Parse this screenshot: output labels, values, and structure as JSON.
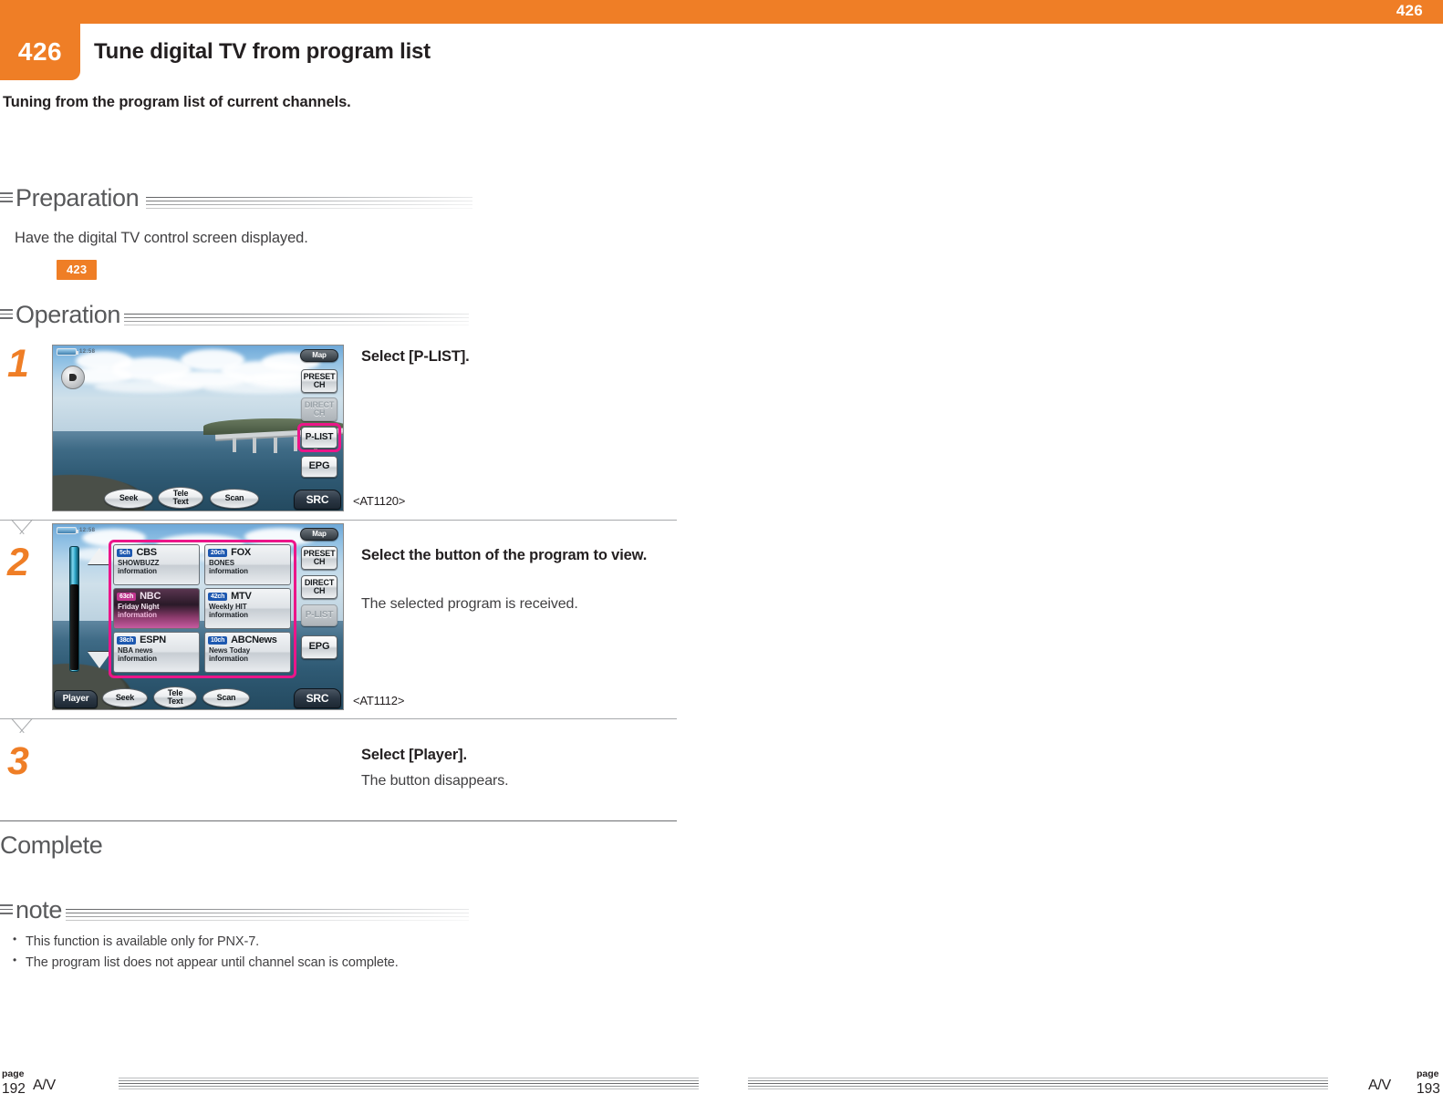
{
  "header": {
    "top_page_number": "426",
    "section_number": "426",
    "title": "Tune digital TV from program list",
    "subtitle": "Tuning from the program list of current channels."
  },
  "preparation": {
    "label": "Preparation",
    "text": "Have the digital TV control screen displayed.",
    "reference_page": "423"
  },
  "operation": {
    "label": "Operation",
    "steps": [
      {
        "number": "1",
        "heading": "Select [P-LIST].",
        "sub": "",
        "caption": "<AT1120>"
      },
      {
        "number": "2",
        "heading": "Select the button of the program to view.",
        "sub": "The selected program is received.",
        "caption": "<AT1112>"
      },
      {
        "number": "3",
        "heading": "Select [Player].",
        "sub": "The button disappears.",
        "caption": ""
      }
    ]
  },
  "complete": {
    "label": "Complete"
  },
  "note": {
    "label": "note",
    "items": [
      "This function is available only for PNX-7.",
      "The program list does not appear until channel scan is complete."
    ]
  },
  "footer": {
    "left_page_label": "page",
    "left_page_number": "192",
    "left_av": "A/V",
    "right_av": "A/V",
    "right_page_label": "page",
    "right_page_number": "193"
  },
  "screen1": {
    "clock": "12:58",
    "buttons": {
      "map": "Map",
      "preset_ch": "PRESET\nCH",
      "direct_ch": "DIRECT\nCH",
      "p_list": "P-LIST",
      "epg": "EPG",
      "src": "SRC",
      "seek": "Seek",
      "teletext": "Tele\nText",
      "scan": "Scan"
    },
    "highlighted": "P-LIST",
    "disabled": "DIRECT CH"
  },
  "screen2": {
    "clock": "12:58",
    "buttons": {
      "map": "Map",
      "preset_ch": "PRESET\nCH",
      "direct_ch": "DIRECT\nCH",
      "p_list": "P-LIST",
      "epg": "EPG",
      "src": "SRC",
      "player": "Player",
      "seek": "Seek",
      "teletext": "Tele\nText",
      "scan": "Scan"
    },
    "disabled": "P-LIST",
    "programs": [
      {
        "channel": "5ch",
        "network": "CBS",
        "title": "SHOWBUZZ",
        "info": "information",
        "selected": false
      },
      {
        "channel": "20ch",
        "network": "FOX",
        "title": "BONES",
        "info": "information",
        "selected": false
      },
      {
        "channel": "63ch",
        "network": "NBC",
        "title": "Friday Night",
        "info": "information",
        "selected": true
      },
      {
        "channel": "42ch",
        "network": "MTV",
        "title": "Weekly HIT",
        "info": "information",
        "selected": false
      },
      {
        "channel": "38ch",
        "network": "ESPN",
        "title": "NBA news",
        "info": "information",
        "selected": false
      },
      {
        "channel": "10ch",
        "network": "ABCNews",
        "title": "News Today",
        "info": "information",
        "selected": false
      }
    ]
  },
  "colors": {
    "accent_orange": "#ef7e26",
    "highlight_magenta": "#ec1589",
    "heading_gray": "#58595b",
    "body_gray": "#414042"
  }
}
